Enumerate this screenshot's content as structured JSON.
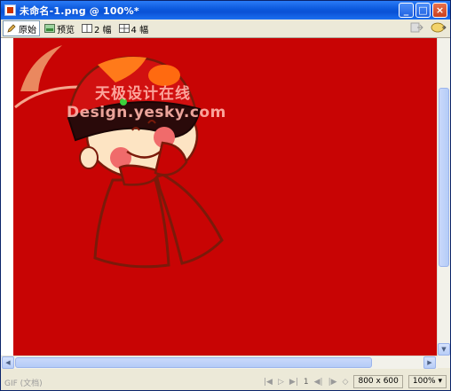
{
  "window": {
    "title": "未命名-1.png @ 100%*",
    "buttons": {
      "minimize": "_",
      "maximize": "□",
      "close": "×"
    }
  },
  "toolbar": {
    "original_label": "原始",
    "preview_label": "预览",
    "two_up_label": "2 幅",
    "four_up_label": "4 幅"
  },
  "watermark": {
    "cn_text": "天极设计在线",
    "en_text": "Design.yesky.com"
  },
  "status": {
    "format_label": "GIF (文档)",
    "frame": "1",
    "size": "800 x 600",
    "zoom": "100%"
  },
  "colors": {
    "canvas_bg": "#c80404",
    "accent": "#0a52d6"
  }
}
